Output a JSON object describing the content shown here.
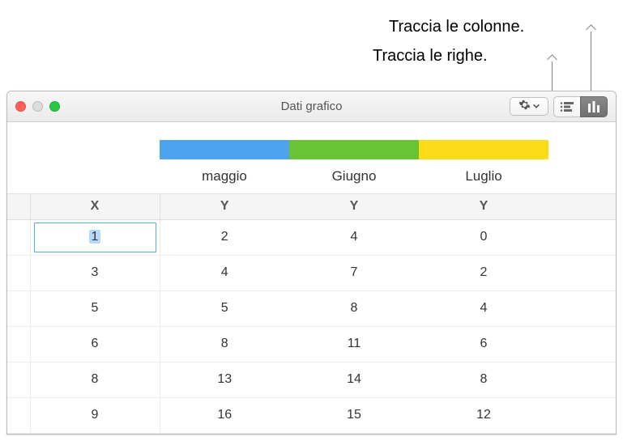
{
  "callouts": {
    "track_columns": "Traccia le colonne.",
    "track_rows": "Traccia le righe."
  },
  "window": {
    "title": "Dati grafico"
  },
  "table": {
    "months": [
      "maggio",
      "Giugno",
      "Luglio"
    ],
    "axis_x": "X",
    "axis_y": "Y",
    "colors": [
      "#4da3ef",
      "#6ac334",
      "#f9dc15"
    ],
    "rows": [
      {
        "x": "1",
        "y": [
          "2",
          "4",
          "0"
        ]
      },
      {
        "x": "3",
        "y": [
          "4",
          "7",
          "2"
        ]
      },
      {
        "x": "5",
        "y": [
          "5",
          "8",
          "4"
        ]
      },
      {
        "x": "6",
        "y": [
          "8",
          "11",
          "6"
        ]
      },
      {
        "x": "8",
        "y": [
          "13",
          "14",
          "8"
        ]
      },
      {
        "x": "9",
        "y": [
          "16",
          "15",
          "12"
        ]
      }
    ],
    "selected_cell": {
      "row": 0,
      "col": "x"
    }
  }
}
